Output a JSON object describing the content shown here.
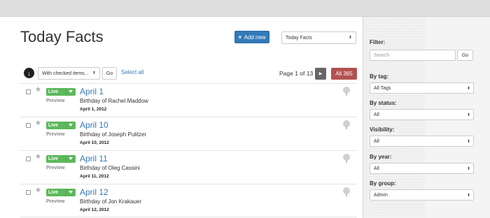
{
  "header": {
    "title": "Today Facts",
    "add_new_label": "Add new",
    "section_select_value": "Today Facts"
  },
  "toolbar": {
    "bulk_select_value": "With checked items...",
    "go_label": "Go",
    "select_all_label": "Select all",
    "pager_text": "Page 1 of 13",
    "all_button_label": "All 365"
  },
  "items": [
    {
      "title": "April 1",
      "description": "Birthday of Rachel Maddow",
      "date": "April 1, 2012",
      "status": "Live",
      "preview_label": "Preview"
    },
    {
      "title": "April 10",
      "description": "Birthday of Joseph Pulitzer",
      "date": "April 10, 2012",
      "status": "Live",
      "preview_label": "Preview"
    },
    {
      "title": "April 11",
      "description": "Birthday of Oleg Cassini",
      "date": "April 11, 2012",
      "status": "Live",
      "preview_label": "Preview"
    },
    {
      "title": "April 12",
      "description": "Birthday of Jon Krakauer",
      "date": "April 12, 2012",
      "status": "Live",
      "preview_label": "Preview"
    }
  ],
  "sidebar": {
    "filter_label": "Filter:",
    "search_placeholder": "Search",
    "go_label": "Go",
    "by_tag_label": "By tag:",
    "by_tag_value": "All Tags",
    "by_status_label": "By status:",
    "by_status_value": "All",
    "visibility_label": "Visibility:",
    "visibility_value": "All",
    "by_year_label": "By year:",
    "by_year_value": "All",
    "by_group_label": "By group:",
    "by_group_value": "Admin"
  },
  "colors": {
    "primary": "#337ab7",
    "live_green": "#5cb85c",
    "all_button": "#b25252",
    "pager_next": "#666666"
  },
  "icons": {
    "add": "plus-icon",
    "bulk_action": "circle-arrow-down-icon",
    "next": "chevron-right-icon",
    "star": "star-icon",
    "pin": "pin-icon"
  }
}
